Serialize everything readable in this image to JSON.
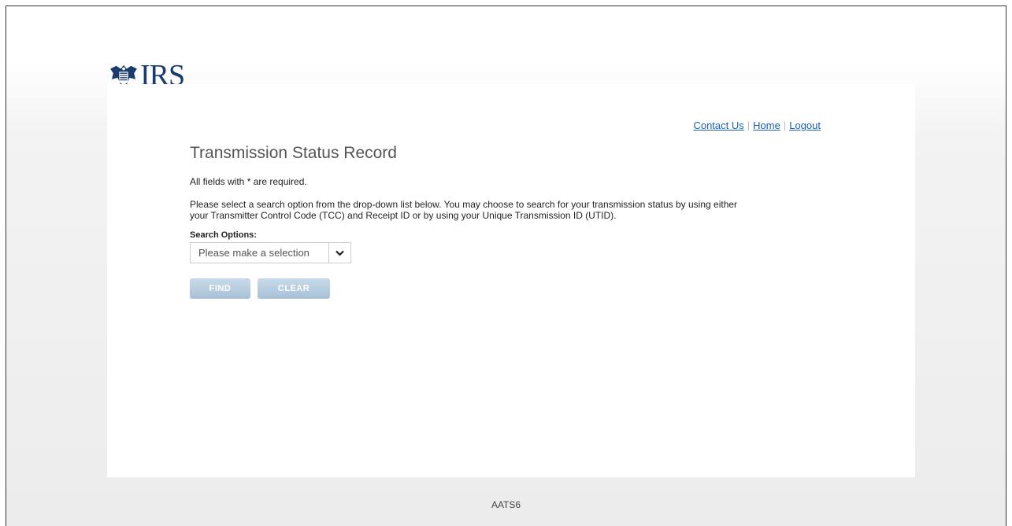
{
  "logo": {
    "text": "IRS",
    "icon": "irs-eagle-icon"
  },
  "nav": {
    "contact": "Contact Us",
    "home": "Home",
    "logout": "Logout"
  },
  "page": {
    "title": "Transmission Status Record",
    "required_note": "All fields with * are required.",
    "instructions_1": "Please select a search option from the drop-down list below. You may choose to search for your transmission status by using either",
    "instructions_2": "your Transmitter Control Code (TCC) and Receipt ID or by using your Unique Transmission ID (UTID)."
  },
  "search": {
    "label": "Search Options:",
    "selected": "Please make a selection",
    "arrow_icon": "chevron-down-icon"
  },
  "buttons": {
    "find": "FIND",
    "clear": "CLEAR"
  },
  "footer": {
    "code": "AATS6"
  },
  "colors": {
    "link": "#1a5fb4",
    "button": "#a7c0d6",
    "logo": "#1a3b6e"
  }
}
